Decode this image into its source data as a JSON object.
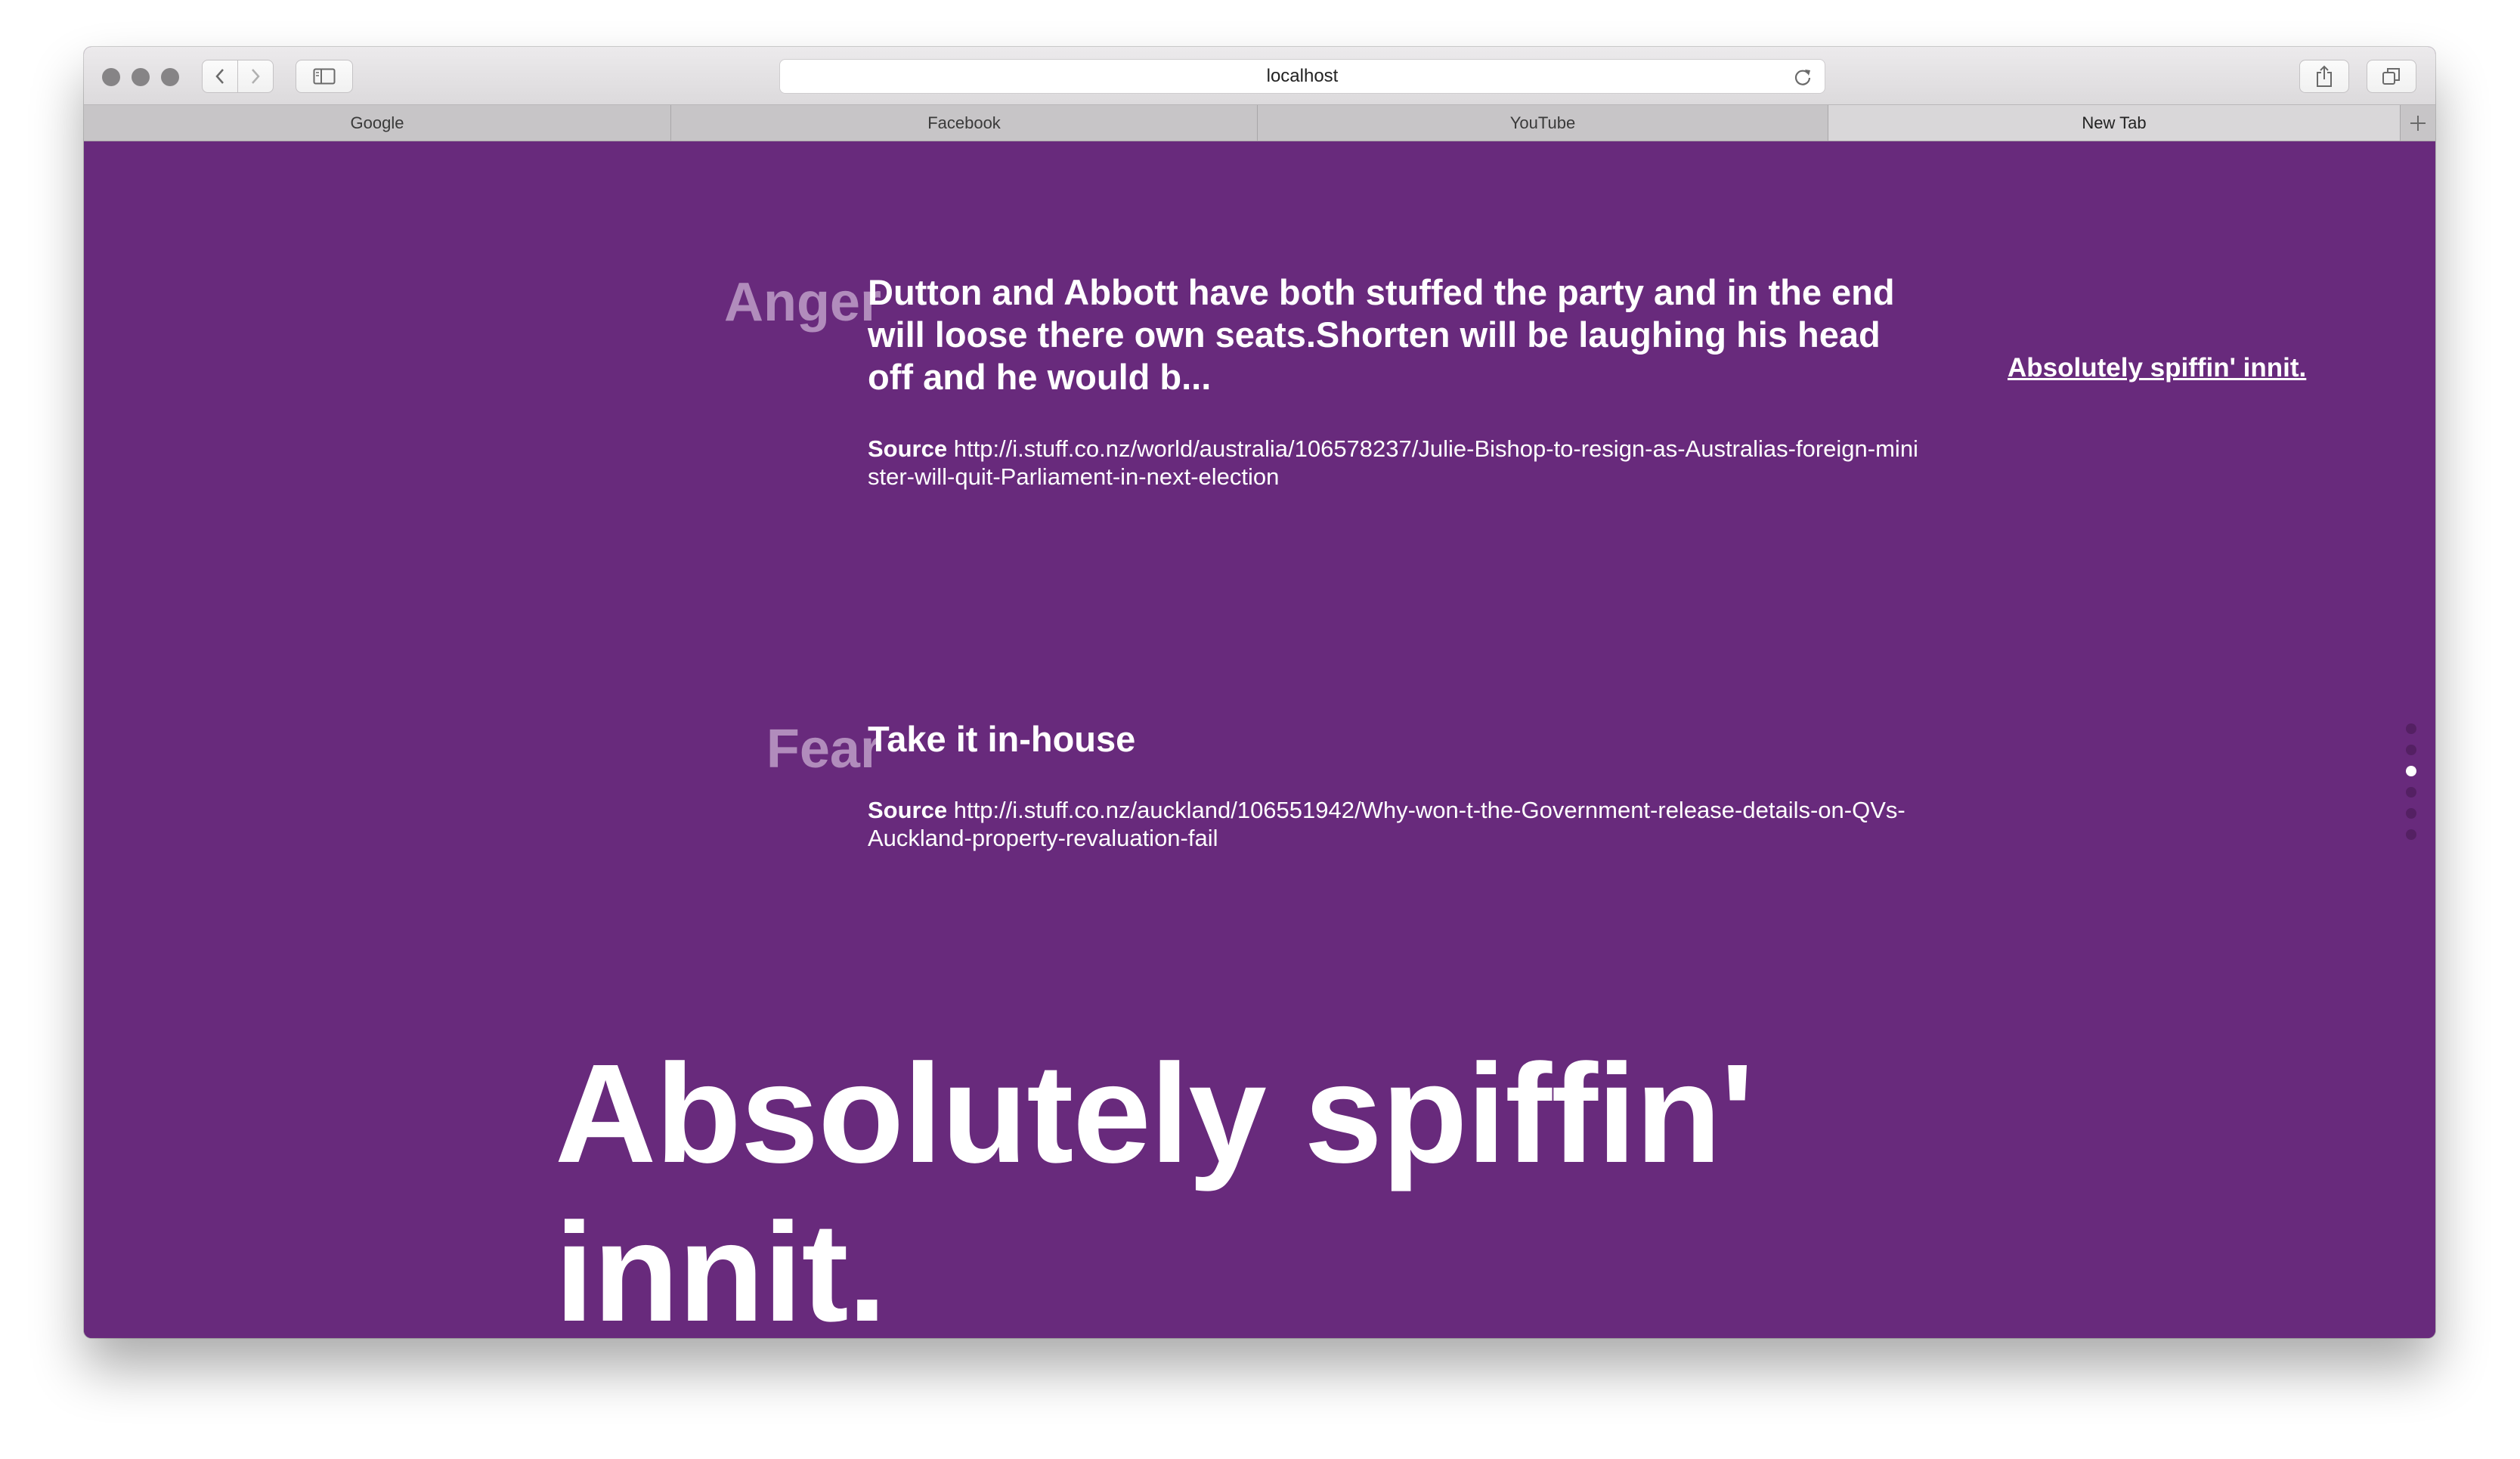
{
  "browser": {
    "address": "localhost",
    "tabs": [
      {
        "label": "Google"
      },
      {
        "label": "Facebook"
      },
      {
        "label": "YouTube"
      },
      {
        "label": "New Tab"
      }
    ],
    "active_tab_index": 3
  },
  "items": [
    {
      "emotion": "Anger",
      "headline": "Dutton and Abbott have both stuffed the party and in the end will loose there own seats.Shorten will be laughing his head off and he would b...",
      "source_label": "Source",
      "source_url": "http://i.stuff.co.nz/world/australia/106578237/Julie-Bishop-to-resign-as-Australias-foreign-minister-will-quit-Parliament-in-next-election"
    },
    {
      "emotion": "Fear",
      "headline": "Take it in-house",
      "source_label": "Source",
      "source_url": "http://i.stuff.co.nz/auckland/106551942/Why-won-t-the-Government-release-details-on-QVs-Auckland-property-revaluation-fail"
    }
  ],
  "side_link": "Absolutely spiffin' innit.",
  "big_title": "Absolutely spiffin' innit.",
  "pagination": {
    "total": 6,
    "active_index": 2
  },
  "colors": {
    "background": "#682a7c",
    "emotion_label": "#b18cbc",
    "text": "#ffffff"
  }
}
